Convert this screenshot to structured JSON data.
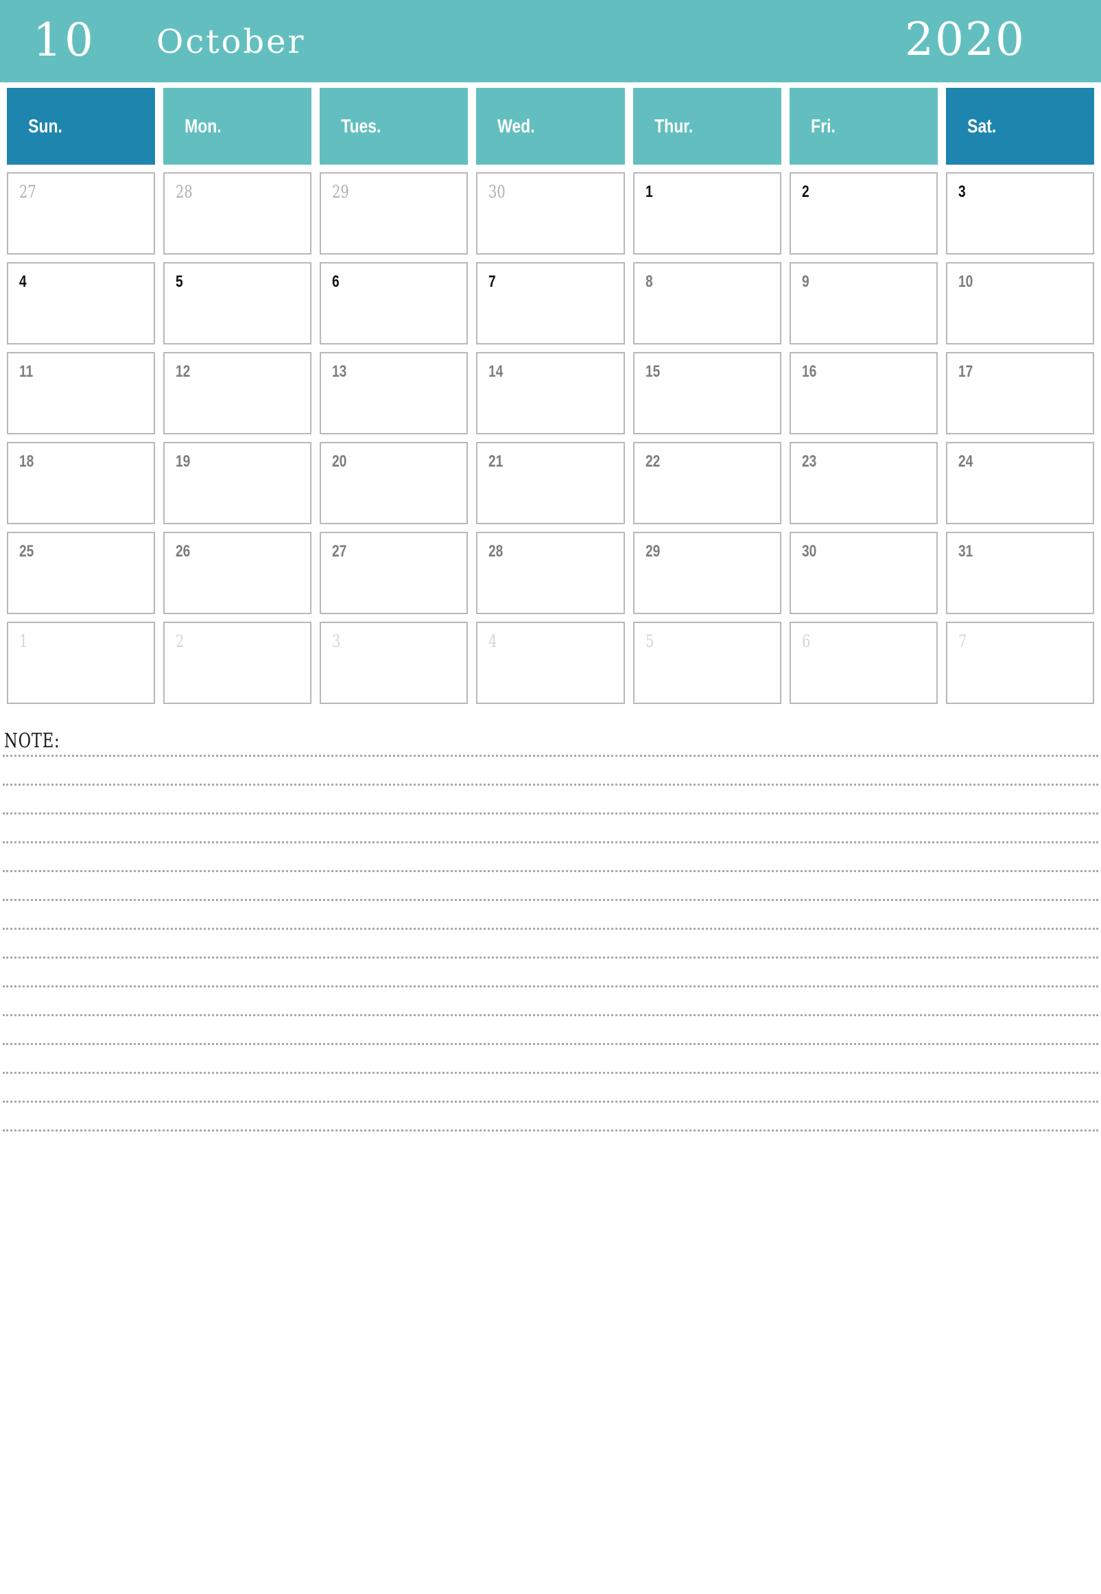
{
  "header": {
    "month_number": "10",
    "month_name": "October",
    "year": "2020",
    "bg_color": "#63bfbf",
    "text_color": "#ffffff"
  },
  "colors": {
    "teal": "#63bfbf",
    "weekend_blue": "#1d85ae",
    "cell_border": "#b8b8b8",
    "day_current_dark": "#111111",
    "day_current": "#7d7d7d",
    "day_prev": "#b0b0b0",
    "day_next": "#d6d6d6",
    "note_rule": "#a8a8a8"
  },
  "weekdays": [
    {
      "label": "Sun.",
      "weekend": true
    },
    {
      "label": "Mon.",
      "weekend": false
    },
    {
      "label": "Tues.",
      "weekend": false
    },
    {
      "label": "Wed.",
      "weekend": false
    },
    {
      "label": "Thur.",
      "weekend": false
    },
    {
      "label": "Fri.",
      "weekend": false
    },
    {
      "label": "Sat.",
      "weekend": true
    }
  ],
  "weeks": [
    [
      {
        "num": "27",
        "kind": "prev"
      },
      {
        "num": "28",
        "kind": "prev"
      },
      {
        "num": "29",
        "kind": "prev"
      },
      {
        "num": "30",
        "kind": "prev"
      },
      {
        "num": "1",
        "kind": "cur-dark"
      },
      {
        "num": "2",
        "kind": "cur-dark"
      },
      {
        "num": "3",
        "kind": "cur-dark"
      }
    ],
    [
      {
        "num": "4",
        "kind": "cur-dark"
      },
      {
        "num": "5",
        "kind": "cur-dark"
      },
      {
        "num": "6",
        "kind": "cur-dark"
      },
      {
        "num": "7",
        "kind": "cur-dark"
      },
      {
        "num": "8",
        "kind": "cur"
      },
      {
        "num": "9",
        "kind": "cur"
      },
      {
        "num": "10",
        "kind": "cur"
      }
    ],
    [
      {
        "num": "11",
        "kind": "cur"
      },
      {
        "num": "12",
        "kind": "cur"
      },
      {
        "num": "13",
        "kind": "cur"
      },
      {
        "num": "14",
        "kind": "cur"
      },
      {
        "num": "15",
        "kind": "cur"
      },
      {
        "num": "16",
        "kind": "cur"
      },
      {
        "num": "17",
        "kind": "cur"
      }
    ],
    [
      {
        "num": "18",
        "kind": "cur"
      },
      {
        "num": "19",
        "kind": "cur"
      },
      {
        "num": "20",
        "kind": "cur"
      },
      {
        "num": "21",
        "kind": "cur"
      },
      {
        "num": "22",
        "kind": "cur"
      },
      {
        "num": "23",
        "kind": "cur"
      },
      {
        "num": "24",
        "kind": "cur"
      }
    ],
    [
      {
        "num": "25",
        "kind": "cur"
      },
      {
        "num": "26",
        "kind": "cur"
      },
      {
        "num": "27",
        "kind": "cur"
      },
      {
        "num": "28",
        "kind": "cur"
      },
      {
        "num": "29",
        "kind": "cur"
      },
      {
        "num": "30",
        "kind": "cur"
      },
      {
        "num": "31",
        "kind": "cur"
      }
    ],
    [
      {
        "num": "1",
        "kind": "next"
      },
      {
        "num": "2",
        "kind": "next"
      },
      {
        "num": "3",
        "kind": "next"
      },
      {
        "num": "4",
        "kind": "next"
      },
      {
        "num": "5",
        "kind": "next"
      },
      {
        "num": "6",
        "kind": "next"
      },
      {
        "num": "7",
        "kind": "next"
      }
    ]
  ],
  "note": {
    "label": "NOTE:",
    "line_count": 14
  }
}
